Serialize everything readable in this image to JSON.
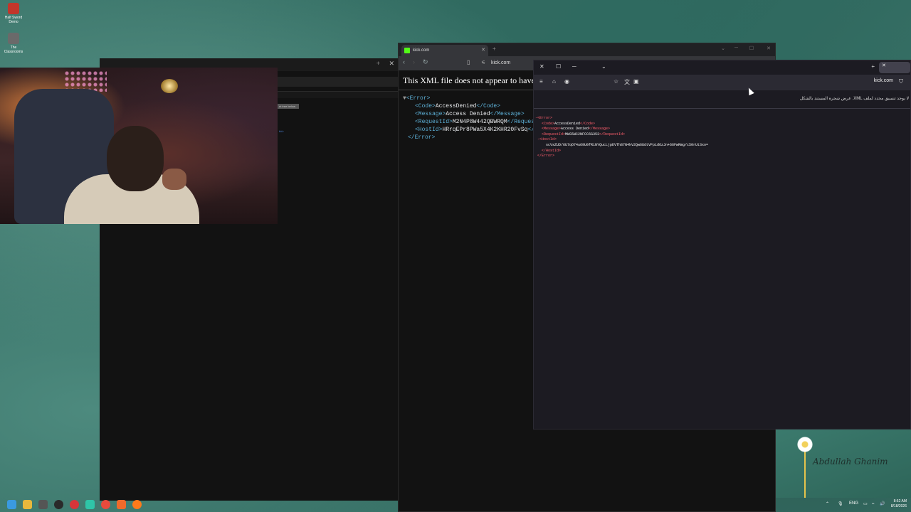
{
  "desktop": {
    "icons": [
      {
        "label": "Half Sword Demo",
        "color": "#c2362b"
      },
      {
        "label": "The Classrooms",
        "color": "#6a6a6a"
      }
    ]
  },
  "chrome": {
    "tab_title": "kick.com",
    "address": "kick.com",
    "notice": "This XML file does not appear to have any style information associated with it. The document tree is shown below.",
    "xml_lines": [
      {
        "indent": 0,
        "open": "<Error>",
        "text": "",
        "close": ""
      },
      {
        "indent": 1,
        "open": "<Code>",
        "text": "AccessDenied",
        "close": "</Code>"
      },
      {
        "indent": 1,
        "open": "<Message>",
        "text": "Access Denied",
        "close": "</Message>"
      },
      {
        "indent": 1,
        "open": "<RequestId>",
        "text": "M2N4P8W442QBWRQM",
        "close": "</RequestId>"
      },
      {
        "indent": 1,
        "open": "<HostId>",
        "text": "HRrqEPr8PWa5X4K2KHR20FvSq",
        "close": "</HostId>"
      },
      {
        "indent": 0,
        "open": "</Error>",
        "text": "",
        "close": ""
      }
    ]
  },
  "firefox": {
    "tab_title": "kick.com",
    "address": "kick.com",
    "info_text": "لا يوجد تنسيق محدد لملف XML. عرض شجرة المستند بالشكل",
    "xml": {
      "error_open": "-<Error>",
      "code": "AccessDenied",
      "message": "Access Denied",
      "request_id": "MWS5WC2NFCC6G353",
      "host_id_open": "-<HostId>",
      "host_id": "scVsZUD/6U7qO74u69U0fR1NYQucLjpEVTh87N4kV2Qw6UdtVFpid6zJn+66FwRmg/c50rUt3xo=",
      "host_id_close": "</HostId>",
      "error_close": "</Error>"
    }
  },
  "left_window": {
    "strip_label": "nt tree below.",
    "tid": "tId>"
  },
  "art": {
    "signature": "Abdullah Ghanim"
  },
  "taskbar": {
    "language": "ENG",
    "time": "8:52 AM",
    "date": "8/18/2026"
  }
}
